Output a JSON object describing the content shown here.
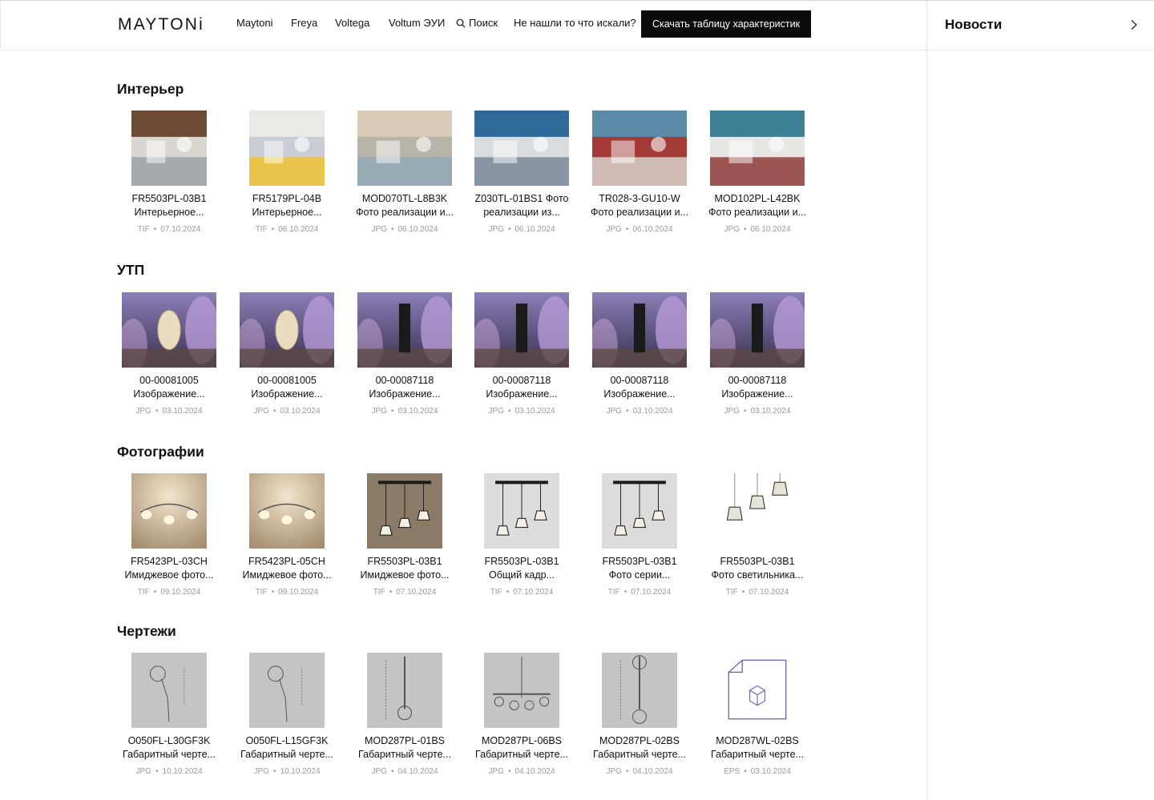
{
  "header": {
    "logo": "MAYTONi",
    "nav": [
      "Maytoni",
      "Freya",
      "Voltega",
      "Voltum ЭУИ"
    ],
    "search_label": "Поиск",
    "not_found": "Не нашли то что искали?",
    "download_button": "Скачать таблицу характеристик"
  },
  "news": {
    "title": "Новости"
  },
  "sections": [
    {
      "title": "Интерьер",
      "items": [
        {
          "code": "FR5503PL-03B1",
          "desc": "Интерьерное...",
          "type": "TIF",
          "date": "07.10.2024"
        },
        {
          "code": "FR5179PL-04B",
          "desc": "Интерьерное...",
          "type": "TIF",
          "date": "06.10.2024"
        },
        {
          "code": "MOD070TL-L8B3K",
          "desc": "Фото реализации и...",
          "type": "JPG",
          "date": "06.10.2024"
        },
        {
          "code": "Z030TL-01BS1 Фото",
          "desc": "реализации из...",
          "type": "JPG",
          "date": "06.10.2024"
        },
        {
          "code": "TR028-3-GU10-W",
          "desc": "Фото реализации и...",
          "type": "JPG",
          "date": "06.10.2024"
        },
        {
          "code": "MOD102PL-L42BK",
          "desc": "Фото реализации и...",
          "type": "JPG",
          "date": "06.10.2024"
        }
      ]
    },
    {
      "title": "УТП",
      "items": [
        {
          "code": "00-00081005",
          "desc": "Изображение...",
          "type": "JPG",
          "date": "03.10.2024"
        },
        {
          "code": "00-00081005",
          "desc": "Изображение...",
          "type": "JPG",
          "date": "03.10.2024"
        },
        {
          "code": "00-00087118",
          "desc": "Изображение...",
          "type": "JPG",
          "date": "03.10.2024"
        },
        {
          "code": "00-00087118",
          "desc": "Изображение...",
          "type": "JPG",
          "date": "03.10.2024"
        },
        {
          "code": "00-00087118",
          "desc": "Изображение...",
          "type": "JPG",
          "date": "03.10.2024"
        },
        {
          "code": "00-00087118",
          "desc": "Изображение...",
          "type": "JPG",
          "date": "03.10.2024"
        }
      ]
    },
    {
      "title": "Фотографии",
      "items": [
        {
          "code": "FR5423PL-03CH",
          "desc": "Имиджевое фото...",
          "type": "TIF",
          "date": "09.10.2024"
        },
        {
          "code": "FR5423PL-05CH",
          "desc": "Имиджевое фото...",
          "type": "TIF",
          "date": "09.10.2024"
        },
        {
          "code": "FR5503PL-03B1",
          "desc": "Имиджевое фото...",
          "type": "TIF",
          "date": "07.10.2024"
        },
        {
          "code": "FR5503PL-03B1",
          "desc": "Общий кадр...",
          "type": "TIF",
          "date": "07.10.2024"
        },
        {
          "code": "FR5503PL-03B1",
          "desc": "Фото серии...",
          "type": "TIF",
          "date": "07.10.2024"
        },
        {
          "code": "FR5503PL-03B1",
          "desc": "Фото светильника...",
          "type": "TIF",
          "date": "07.10.2024"
        }
      ]
    },
    {
      "title": "Чертежи",
      "items": [
        {
          "code": "O050FL-L30GF3K",
          "desc": "Габаритный черте...",
          "type": "JPG",
          "date": "10.10.2024"
        },
        {
          "code": "O050FL-L15GF3K",
          "desc": "Габаритный черте...",
          "type": "JPG",
          "date": "10.10.2024"
        },
        {
          "code": "MOD287PL-01BS",
          "desc": "Габаритный черте...",
          "type": "JPG",
          "date": "04.10.2024"
        },
        {
          "code": "MOD287PL-06BS",
          "desc": "Габаритный черте...",
          "type": "JPG",
          "date": "04.10.2024"
        },
        {
          "code": "MOD287PL-02BS",
          "desc": "Габаритный черте...",
          "type": "JPG",
          "date": "04.10.2024"
        },
        {
          "code": "MOD287WL-02BS",
          "desc": "Габаритный черте...",
          "type": "EPS",
          "date": "03.10.2024"
        }
      ]
    }
  ]
}
